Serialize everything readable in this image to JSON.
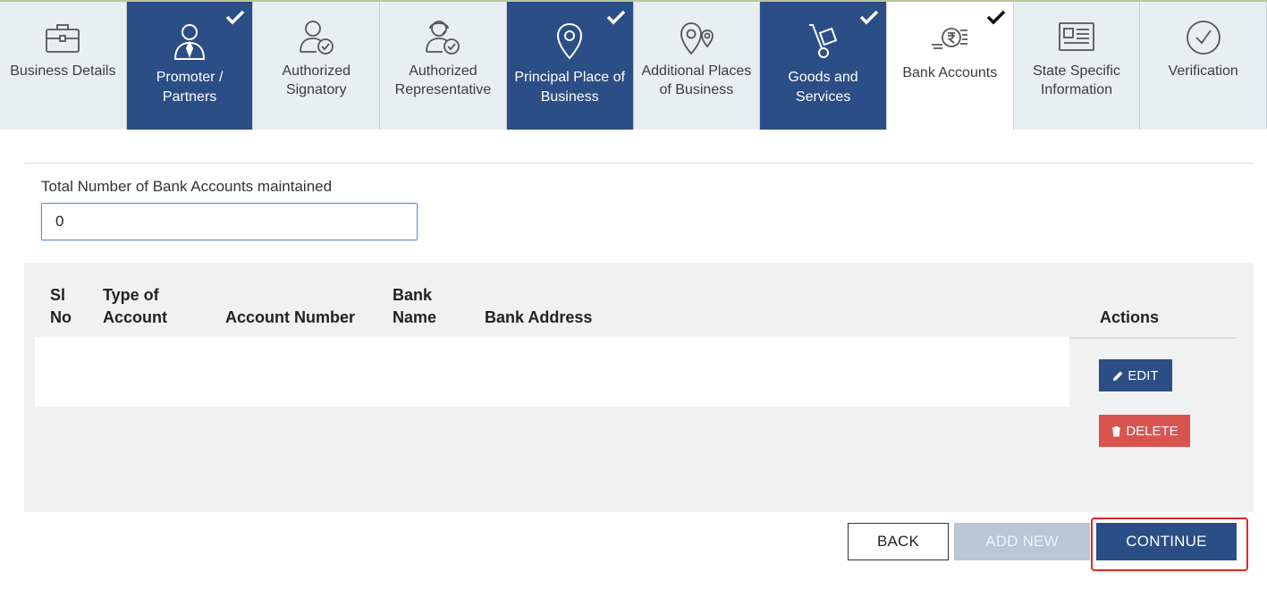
{
  "tabs": [
    {
      "label": "Business Details",
      "state": "default",
      "icon": "briefcase-icon"
    },
    {
      "label": "Promoter / Partners",
      "state": "done",
      "icon": "person-tie-icon"
    },
    {
      "label": "Authorized Signatory",
      "state": "default",
      "icon": "person-check-icon"
    },
    {
      "label": "Authorized Representative",
      "state": "default",
      "icon": "headset-person-check-icon"
    },
    {
      "label": "Principal Place of Business",
      "state": "done",
      "icon": "location-pin-icon"
    },
    {
      "label": "Additional Places of Business",
      "state": "default",
      "icon": "location-pins-icon"
    },
    {
      "label": "Goods and Services",
      "state": "done",
      "icon": "hand-truck-icon"
    },
    {
      "label": "Bank Accounts",
      "state": "active",
      "icon": "rupee-coin-icon"
    },
    {
      "label": "State Specific Information",
      "state": "default",
      "icon": "id-card-icon"
    },
    {
      "label": "Verification",
      "state": "default",
      "icon": "check-circle-icon"
    }
  ],
  "form": {
    "count_label": "Total Number of Bank Accounts maintained",
    "count_value": "0"
  },
  "table": {
    "headers": {
      "sl_no": "Sl No",
      "type": "Type of Account",
      "account_number": "Account Number",
      "bank_name": "Bank Name",
      "bank_address": "Bank Address",
      "actions": "Actions"
    },
    "edit_label": "EDIT",
    "delete_label": "DELETE"
  },
  "footer": {
    "back_label": "BACK",
    "add_new_label": "ADD NEW",
    "continue_label": "CONTINUE"
  },
  "colors": {
    "primary": "#2c4e86",
    "danger": "#d9534f",
    "highlight": "#e32626",
    "disabled": "#b8c6d6"
  }
}
